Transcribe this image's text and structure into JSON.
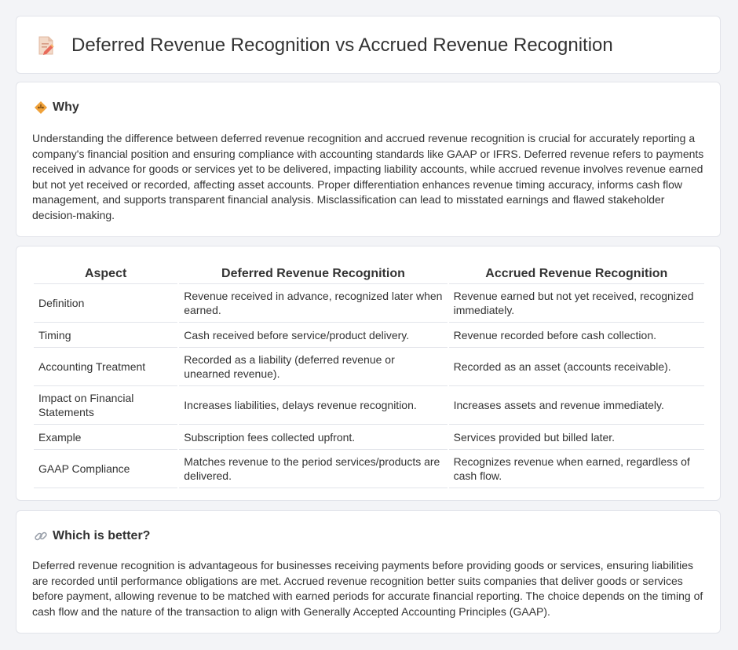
{
  "header": {
    "title": "Deferred Revenue Recognition vs Accrued Revenue Recognition",
    "icon": "document-edit-icon"
  },
  "why": {
    "icon": "diamond-warning-icon",
    "title": "Why",
    "body": "Understanding the difference between deferred revenue recognition and accrued revenue recognition is crucial for accurately reporting a company's financial position and ensuring compliance with accounting standards like GAAP or IFRS. Deferred revenue refers to payments received in advance for goods or services yet to be delivered, impacting liability accounts, while accrued revenue involves revenue earned but not yet received or recorded, affecting asset accounts. Proper differentiation enhances revenue timing accuracy, informs cash flow management, and supports transparent financial analysis. Misclassification can lead to misstated earnings and flawed stakeholder decision-making."
  },
  "comparison": {
    "headers": [
      "Aspect",
      "Deferred Revenue Recognition",
      "Accrued Revenue Recognition"
    ],
    "rows": [
      [
        "Definition",
        "Revenue received in advance, recognized later when earned.",
        "Revenue earned but not yet received, recognized immediately."
      ],
      [
        "Timing",
        "Cash received before service/product delivery.",
        "Revenue recorded before cash collection."
      ],
      [
        "Accounting Treatment",
        "Recorded as a liability (deferred revenue or unearned revenue).",
        "Recorded as an asset (accounts receivable)."
      ],
      [
        "Impact on Financial Statements",
        "Increases liabilities, delays revenue recognition.",
        "Increases assets and revenue immediately."
      ],
      [
        "Example",
        "Subscription fees collected upfront.",
        "Services provided but billed later."
      ],
      [
        "GAAP Compliance",
        "Matches revenue to the period services/products are delivered.",
        "Recognizes revenue when earned, regardless of cash flow."
      ]
    ]
  },
  "better": {
    "icon": "link-icon",
    "title": "Which is better?",
    "body": "Deferred revenue recognition is advantageous for businesses receiving payments before providing goods or services, ensuring liabilities are recorded until performance obligations are met. Accrued revenue recognition better suits companies that deliver goods or services before payment, allowing revenue to be matched with earned periods for accurate financial reporting. The choice depends on the timing of cash flow and the nature of the transaction to align with Generally Accepted Accounting Principles (GAAP)."
  },
  "colors": {
    "background": "#f3f4f7",
    "card": "#ffffff",
    "border": "#e2e4ea",
    "text": "#333333",
    "icon_accent": "#f0a23a",
    "icon_pink": "#e86a8c"
  }
}
